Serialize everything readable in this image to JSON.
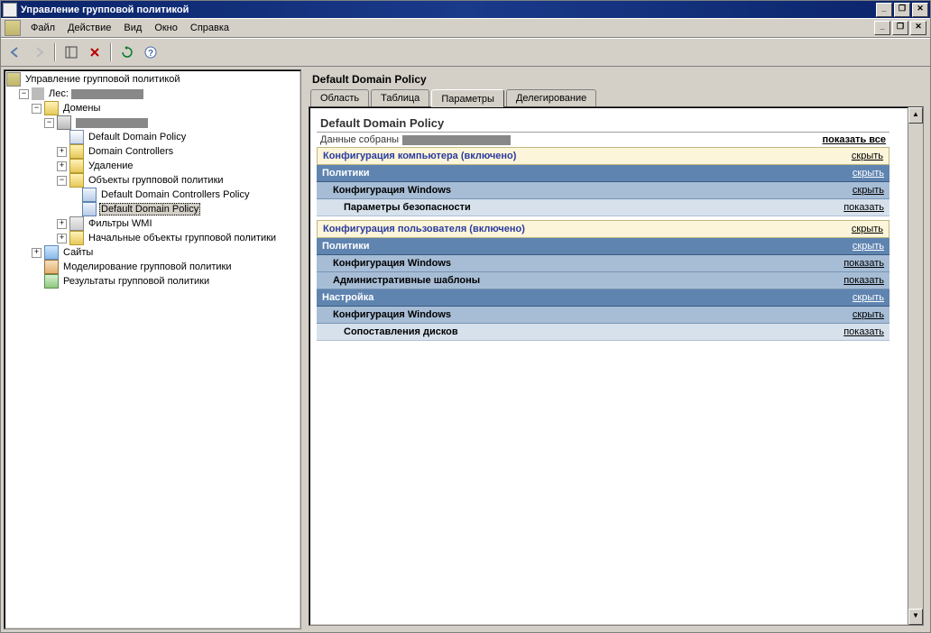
{
  "window_title": "Управление групповой политикой",
  "menu": [
    "Файл",
    "Действие",
    "Вид",
    "Окно",
    "Справка"
  ],
  "tree": {
    "root": "Управление групповой политикой",
    "forest_label": "Лес:",
    "domains": "Домены",
    "ddp_link": "Default Domain Policy",
    "dc": "Domain Controllers",
    "del": "Удаление",
    "gpo_objects": "Объекты групповой политики",
    "ddcp": "Default Domain Controllers Policy",
    "ddp_selected": "Default Domain Policy",
    "wmi": "Фильтры WMI",
    "starter": "Начальные объекты групповой политики",
    "sites": "Сайты",
    "modeling": "Моделирование групповой политики",
    "results": "Результаты групповой политики"
  },
  "main": {
    "title": "Default Domain Policy",
    "tabs": [
      "Область",
      "Таблица",
      "Параметры",
      "Делегирование"
    ],
    "active_tab": 2,
    "details_title": "Default Domain Policy",
    "data_collected": "Данные собраны",
    "show_all": "показать все",
    "sections": {
      "comp_cfg": "Конфигурация компьютера (включено)",
      "user_cfg": "Конфигурация пользователя (включено)",
      "policies": "Политики",
      "win_cfg": "Конфигурация Windows",
      "sec_params": "Параметры безопасности",
      "admin_tmpl": "Административные шаблоны",
      "pref": "Настройка",
      "drive_maps": "Сопоставления дисков",
      "hide": "скрыть",
      "show": "показать"
    }
  }
}
